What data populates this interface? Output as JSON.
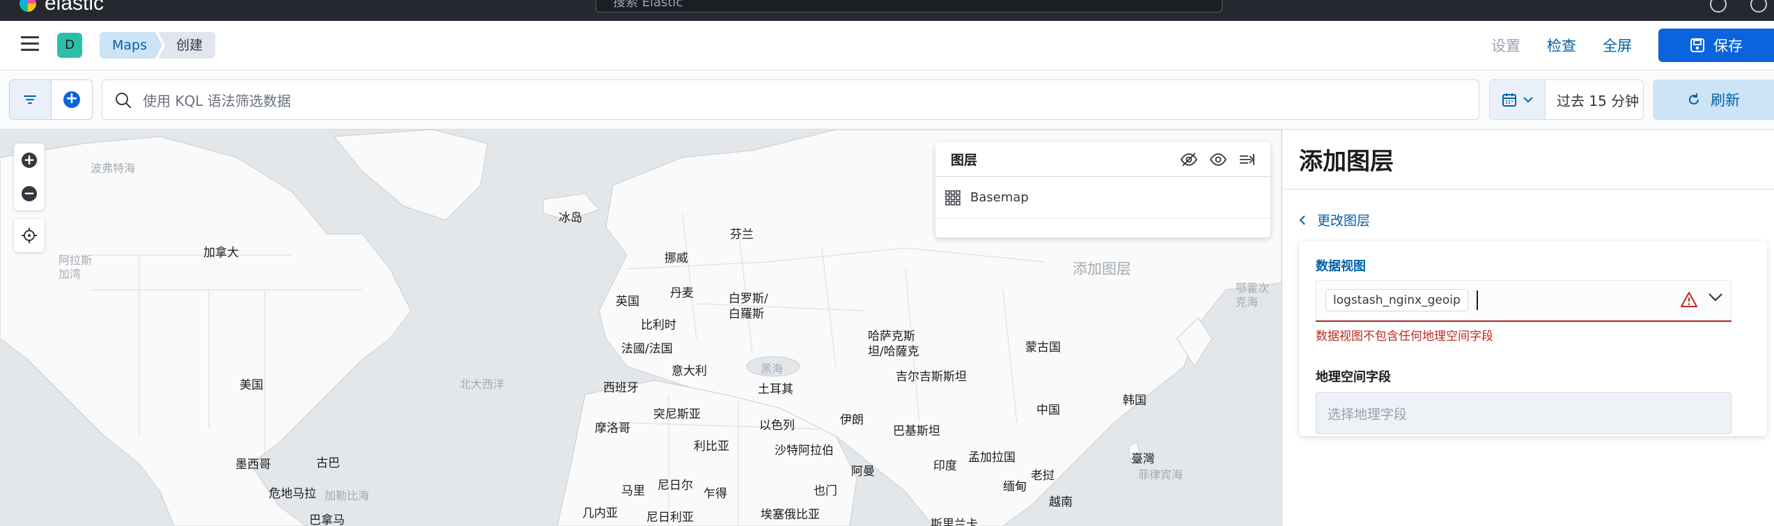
{
  "header": {
    "brand": "elastic",
    "search_placeholder": "搜索 Elastic"
  },
  "appbar": {
    "space_initial": "D",
    "breadcrumbs": [
      "Maps",
      "创建"
    ],
    "actions": {
      "settings": "设置",
      "inspect": "检查",
      "fullscreen": "全屏",
      "save": "保存"
    }
  },
  "querybar": {
    "kql_placeholder": "使用 KQL 语法筛选数据",
    "time_range": "过去 15 分钟",
    "refresh": "刷新"
  },
  "map": {
    "labels": [
      {
        "text": "波弗特海",
        "kind": "sea"
      },
      {
        "text": "冰岛",
        "kind": "land"
      },
      {
        "text": "芬兰",
        "kind": "land"
      },
      {
        "text": "加拿大",
        "kind": "land"
      },
      {
        "text": "阿拉斯\n加湾",
        "kind": "sea"
      },
      {
        "text": "挪威",
        "kind": "land"
      },
      {
        "text": "丹麦",
        "kind": "land"
      },
      {
        "text": "英国",
        "kind": "land"
      },
      {
        "text": "白罗斯/\n白羅斯",
        "kind": "land"
      },
      {
        "text": "比利时",
        "kind": "land"
      },
      {
        "text": "法國/法国",
        "kind": "land"
      },
      {
        "text": "意大利",
        "kind": "land"
      },
      {
        "text": "哈萨克斯\n坦/哈薩克",
        "kind": "land"
      },
      {
        "text": "蒙古国",
        "kind": "land"
      },
      {
        "text": "吉尔吉斯斯坦",
        "kind": "land"
      },
      {
        "text": "黑海",
        "kind": "sea"
      },
      {
        "text": "美国",
        "kind": "land"
      },
      {
        "text": "北大西洋",
        "kind": "sea"
      },
      {
        "text": "西班牙",
        "kind": "land"
      },
      {
        "text": "土耳其",
        "kind": "land"
      },
      {
        "text": "中国",
        "kind": "land"
      },
      {
        "text": "韩国",
        "kind": "land"
      },
      {
        "text": "突尼斯亚",
        "kind": "land"
      },
      {
        "text": "摩洛哥",
        "kind": "land"
      },
      {
        "text": "以色列",
        "kind": "land"
      },
      {
        "text": "伊朗",
        "kind": "land"
      },
      {
        "text": "巴基斯坦",
        "kind": "land"
      },
      {
        "text": "利比亚",
        "kind": "land"
      },
      {
        "text": "沙特阿拉伯",
        "kind": "land"
      },
      {
        "text": "孟加拉国",
        "kind": "land"
      },
      {
        "text": "墨西哥",
        "kind": "land"
      },
      {
        "text": "古巴",
        "kind": "land"
      },
      {
        "text": "印度",
        "kind": "land"
      },
      {
        "text": "臺灣",
        "kind": "land"
      },
      {
        "text": "阿曼",
        "kind": "land"
      },
      {
        "text": "老挝",
        "kind": "land"
      },
      {
        "text": "菲律宾海",
        "kind": "sea"
      },
      {
        "text": "危地马拉",
        "kind": "land"
      },
      {
        "text": "加勒比海",
        "kind": "sea"
      },
      {
        "text": "尼日尔",
        "kind": "land"
      },
      {
        "text": "乍得",
        "kind": "land"
      },
      {
        "text": "也门",
        "kind": "land"
      },
      {
        "text": "缅甸",
        "kind": "land"
      },
      {
        "text": "马里",
        "kind": "land"
      },
      {
        "text": "越南",
        "kind": "land"
      },
      {
        "text": "几内亚",
        "kind": "land"
      },
      {
        "text": "尼日利亚",
        "kind": "land"
      },
      {
        "text": "埃塞俄比亚",
        "kind": "land"
      },
      {
        "text": "巴拿马",
        "kind": "land"
      },
      {
        "text": "斯里兰卡",
        "kind": "land"
      },
      {
        "text": "鄂霍次\n克海",
        "kind": "sea"
      },
      {
        "text": "添加图层",
        "kind": "sea"
      }
    ],
    "layer_panel": {
      "title": "图层",
      "layers": [
        "Basemap"
      ]
    }
  },
  "panel": {
    "title": "添加图层",
    "back_link": "更改图层",
    "data_view_label": "数据视图",
    "data_view_value": "logstash_nginx_geoip",
    "error": "数据视图不包含任何地理空间字段",
    "geo_field_label": "地理空间字段",
    "geo_field_placeholder": "选择地理字段"
  }
}
